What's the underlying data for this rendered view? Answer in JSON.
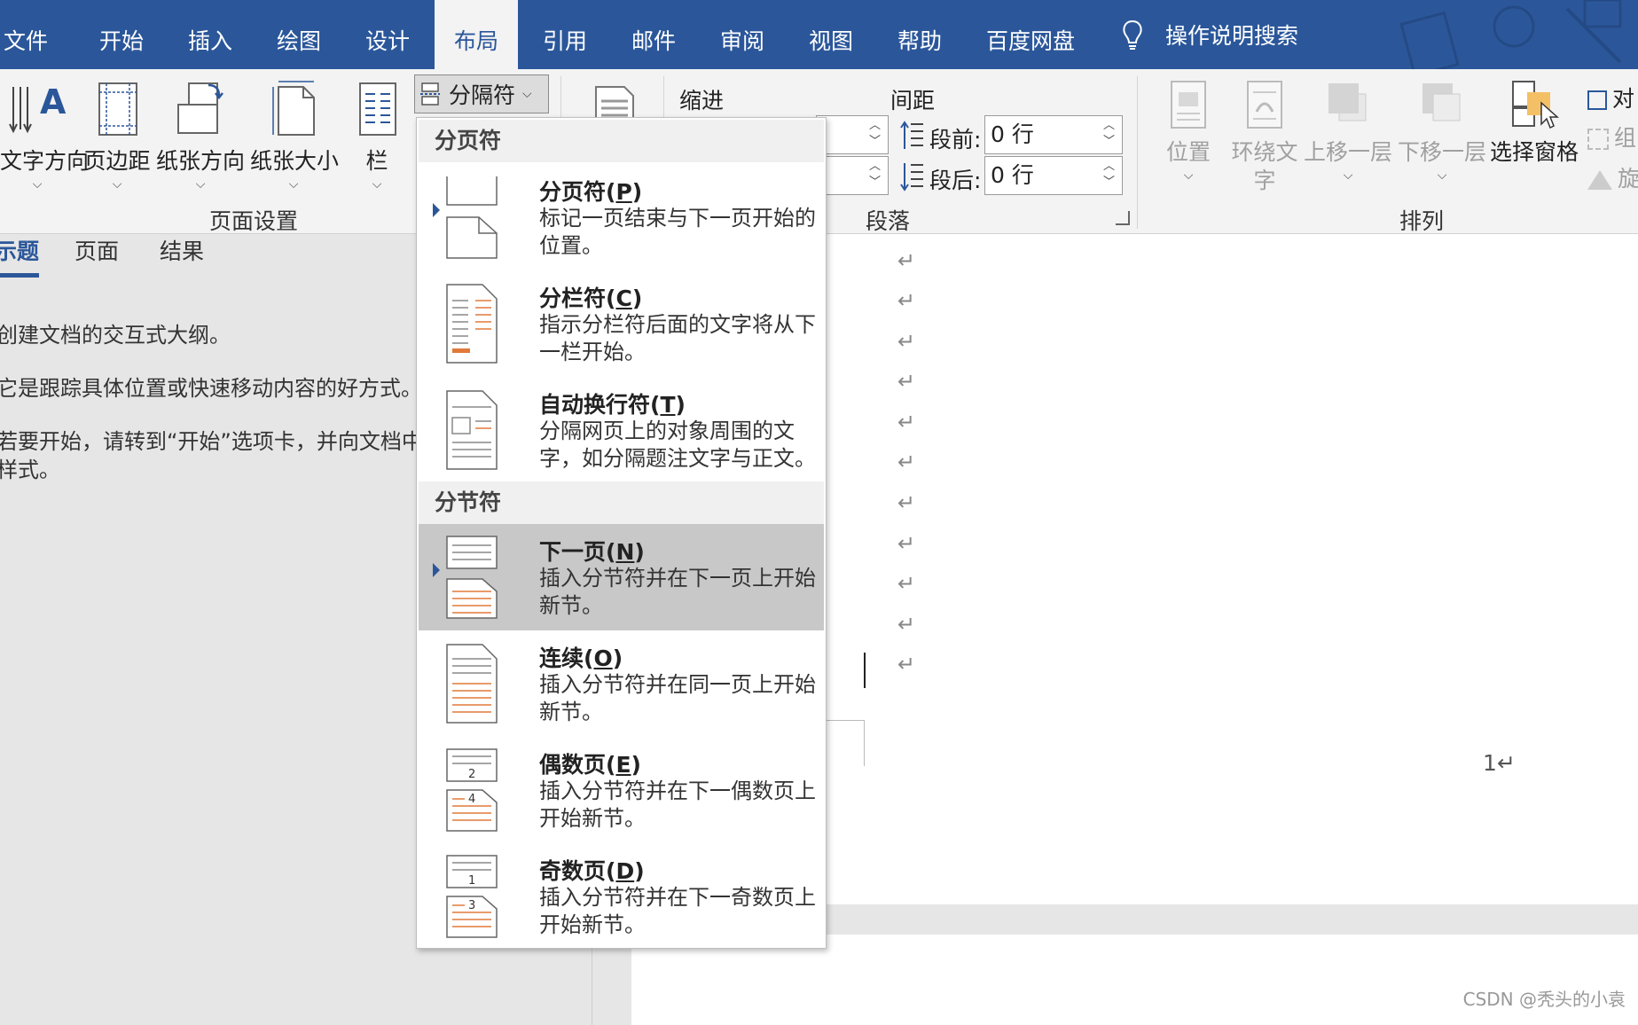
{
  "tabs": [
    "文件",
    "开始",
    "插入",
    "绘图",
    "设计",
    "布局",
    "引用",
    "邮件",
    "审阅",
    "视图",
    "帮助",
    "百度网盘"
  ],
  "active_tab": "布局",
  "search_label": "操作说明搜索",
  "ribbon": {
    "page_setup": {
      "text_direction": "文字方向",
      "margins": "页边距",
      "orientation": "纸张方向",
      "size": "纸张大小",
      "columns": "栏",
      "breaks": "分隔符",
      "group_label": "页面设置"
    },
    "paragraph": {
      "indent_label": "缩进",
      "spacing_label": "间距",
      "before_label": "段前:",
      "after_label": "段后:",
      "before_value": "0 行",
      "after_value": "0 行",
      "group_label": "段落"
    },
    "arrange": {
      "position": "位置",
      "wrap_text_line1": "环绕文",
      "wrap_text_line2": "字",
      "bring_forward": "上移一层",
      "send_backward": "下移一层",
      "selection_pane": "选择窗格",
      "align_partial": "对",
      "group_partial": "组",
      "rotate_partial": "旋",
      "group_label": "排列"
    }
  },
  "nav": {
    "tabs": [
      "标题",
      "页面",
      "结果"
    ],
    "tab_visible": [
      "示题",
      "页面",
      "结果"
    ],
    "lines": [
      "创建文档的交互式大纲。",
      "它是跟踪具体位置或快速移动内容的好方式。",
      "若要开始，请转到“开始”选项卡，并向文档中的",
      "样式。"
    ]
  },
  "menu": {
    "section_page_breaks": "分页符",
    "section_section_breaks": "分节符",
    "items": [
      {
        "title": "分页符",
        "key": "P",
        "desc": "标记一页结束与下一页开始的位置。"
      },
      {
        "title": "分栏符",
        "key": "C",
        "desc": "指示分栏符后面的文字将从下一栏开始。"
      },
      {
        "title": "自动换行符",
        "key": "T",
        "desc": "分隔网页上的对象周围的文字，如分隔题注文字与正文。"
      },
      {
        "title": "下一页",
        "key": "N",
        "desc": "插入分节符并在下一页上开始新节。"
      },
      {
        "title": "连续",
        "key": "O",
        "desc": "插入分节符并在同一页上开始新节。"
      },
      {
        "title": "偶数页",
        "key": "E",
        "desc": "插入分节符并在下一偶数页上开始新节。"
      },
      {
        "title": "奇数页",
        "key": "D",
        "desc": "插入分节符并在下一奇数页上开始新节。"
      }
    ],
    "highlighted_item": "下一页"
  },
  "document": {
    "paragraph_mark": "↵",
    "page_number": "1↵"
  },
  "watermark": "CSDN @秃头的小袁",
  "colors": {
    "accent": "#2b579a",
    "section_icon": "#e07a3a",
    "highlight": "#c8c8c8"
  }
}
